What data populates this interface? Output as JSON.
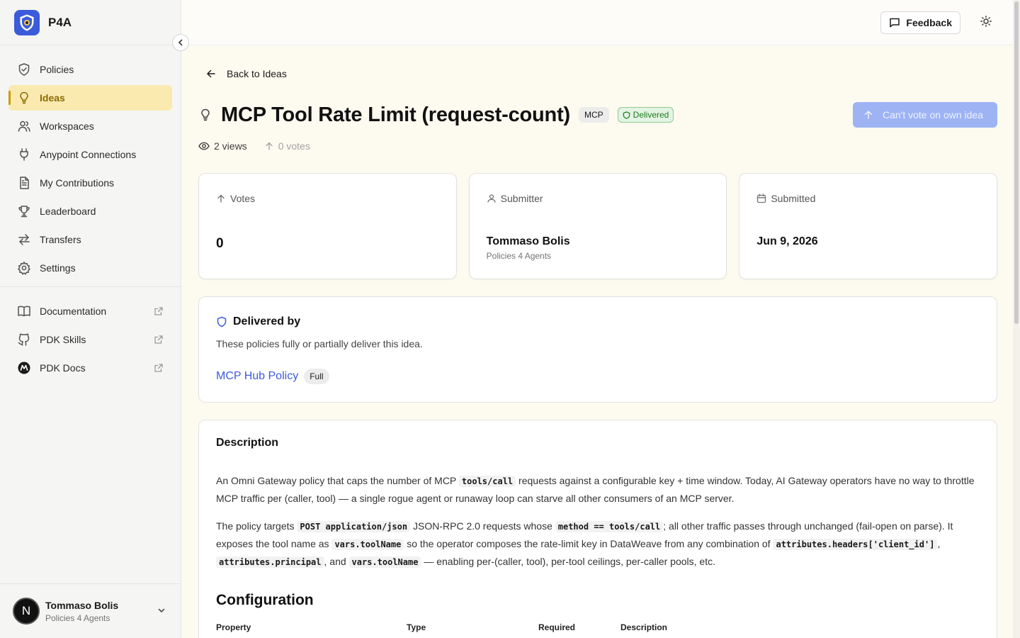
{
  "app": {
    "name": "P4A"
  },
  "sidebar": {
    "items": [
      {
        "label": "Policies",
        "icon": "shield-check-icon"
      },
      {
        "label": "Ideas",
        "icon": "lightbulb-icon",
        "active": true
      },
      {
        "label": "Workspaces",
        "icon": "users-icon"
      },
      {
        "label": "Anypoint Connections",
        "icon": "plug-icon"
      },
      {
        "label": "My Contributions",
        "icon": "document-icon"
      },
      {
        "label": "Leaderboard",
        "icon": "trophy-icon"
      },
      {
        "label": "Transfers",
        "icon": "arrows-swap-icon"
      },
      {
        "label": "Settings",
        "icon": "gear-icon"
      }
    ],
    "links": [
      {
        "label": "Documentation",
        "icon": "book-icon"
      },
      {
        "label": "PDK Skills",
        "icon": "github-icon"
      },
      {
        "label": "PDK Docs",
        "icon": "mulesoft-icon"
      }
    ],
    "user": {
      "initial": "N",
      "name": "Tommaso Bolis",
      "org": "Policies 4 Agents"
    }
  },
  "topbar": {
    "feedback_label": "Feedback"
  },
  "idea": {
    "back_label": "Back to Ideas",
    "title": "MCP Tool Rate Limit (request-count)",
    "tag": "MCP",
    "status": "Delivered",
    "vote_button": "Can't vote on own idea",
    "views": "2 views",
    "votes_text": "0 votes"
  },
  "cards": {
    "votes": {
      "label": "Votes",
      "value": "0"
    },
    "submitter": {
      "label": "Submitter",
      "name": "Tommaso Bolis",
      "org": "Policies 4 Agents"
    },
    "submitted": {
      "label": "Submitted",
      "date": "Jun 9, 2026"
    }
  },
  "delivered_by": {
    "title": "Delivered by",
    "description": "These policies fully or partially deliver this idea.",
    "policy": "MCP Hub Policy",
    "coverage": "Full"
  },
  "description": {
    "heading": "Description",
    "p1": {
      "t1": "An Omni Gateway policy that caps the number of MCP ",
      "c1": "tools/call",
      "t2": " requests against a configurable key + time window. Today, AI Gateway operators have no way to throttle MCP traffic per (caller, tool) — a single rogue agent or runaway loop can starve all other consumers of an MCP server."
    },
    "p2": {
      "t1": "The policy targets ",
      "c1": "POST application/json",
      "t2": " JSON-RPC 2.0 requests whose ",
      "c2": "method == tools/call",
      "t3": "; all other traffic passes through unchanged (fail-open on parse). It exposes the tool name as ",
      "c3": "vars.toolName",
      "t4": " so the operator composes the rate-limit key in DataWeave from any combination of ",
      "c4": "attributes.headers['client_id']",
      "t5": ", ",
      "c5": "attributes.principal",
      "t6": ", and ",
      "c6": "vars.toolName",
      "t7": " — enabling per-(caller, tool), per-tool ceilings, per-caller pools, etc."
    },
    "config_heading": "Configuration",
    "table_headers": [
      "Property",
      "Type",
      "Required",
      "Description"
    ]
  },
  "colors": {
    "accent": "#3b5bdb",
    "active_bg": "#fbeab0",
    "active_text": "#8a6a00",
    "delivered_green": "#1f7a1f"
  }
}
